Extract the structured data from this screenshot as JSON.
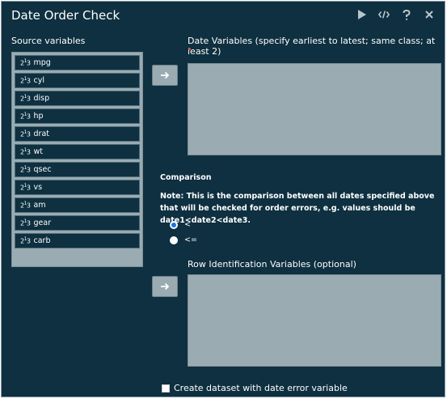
{
  "window": {
    "title": "Date Order Check"
  },
  "toolbar": {
    "run_icon": "play-icon",
    "code_icon": "code-icon",
    "help_icon": "help-icon",
    "close_icon": "close-icon"
  },
  "source": {
    "label": "Source variables",
    "items": [
      {
        "label": "mpg",
        "icon": "numeric-icon"
      },
      {
        "label": "cyl",
        "icon": "numeric-icon"
      },
      {
        "label": "disp",
        "icon": "numeric-icon"
      },
      {
        "label": "hp",
        "icon": "numeric-icon"
      },
      {
        "label": "drat",
        "icon": "numeric-icon"
      },
      {
        "label": "wt",
        "icon": "numeric-icon"
      },
      {
        "label": "qsec",
        "icon": "numeric-icon"
      },
      {
        "label": "vs",
        "icon": "numeric-icon"
      },
      {
        "label": "am",
        "icon": "numeric-icon"
      },
      {
        "label": "gear",
        "icon": "numeric-icon"
      },
      {
        "label": "carb",
        "icon": "numeric-icon"
      }
    ]
  },
  "date_vars": {
    "label": "Date Variables (specify earliest to latest; same class; at least 2)"
  },
  "comparison": {
    "title": "Comparison",
    "note": "Note: This is the comparison between all dates specified above that will be checked for order errors, e.g. values should be date1<date2<date3.",
    "options": [
      {
        "label": "<",
        "checked": true
      },
      {
        "label": "<=",
        "checked": false
      }
    ]
  },
  "row_id": {
    "label": "Row Identification Variables (optional)"
  },
  "create_dataset": {
    "label": "Create dataset with date error variable",
    "checked": false
  },
  "colors": {
    "background": "#0e3040",
    "panel": "#9aabb2",
    "radio_accent": "#1a73e8"
  }
}
